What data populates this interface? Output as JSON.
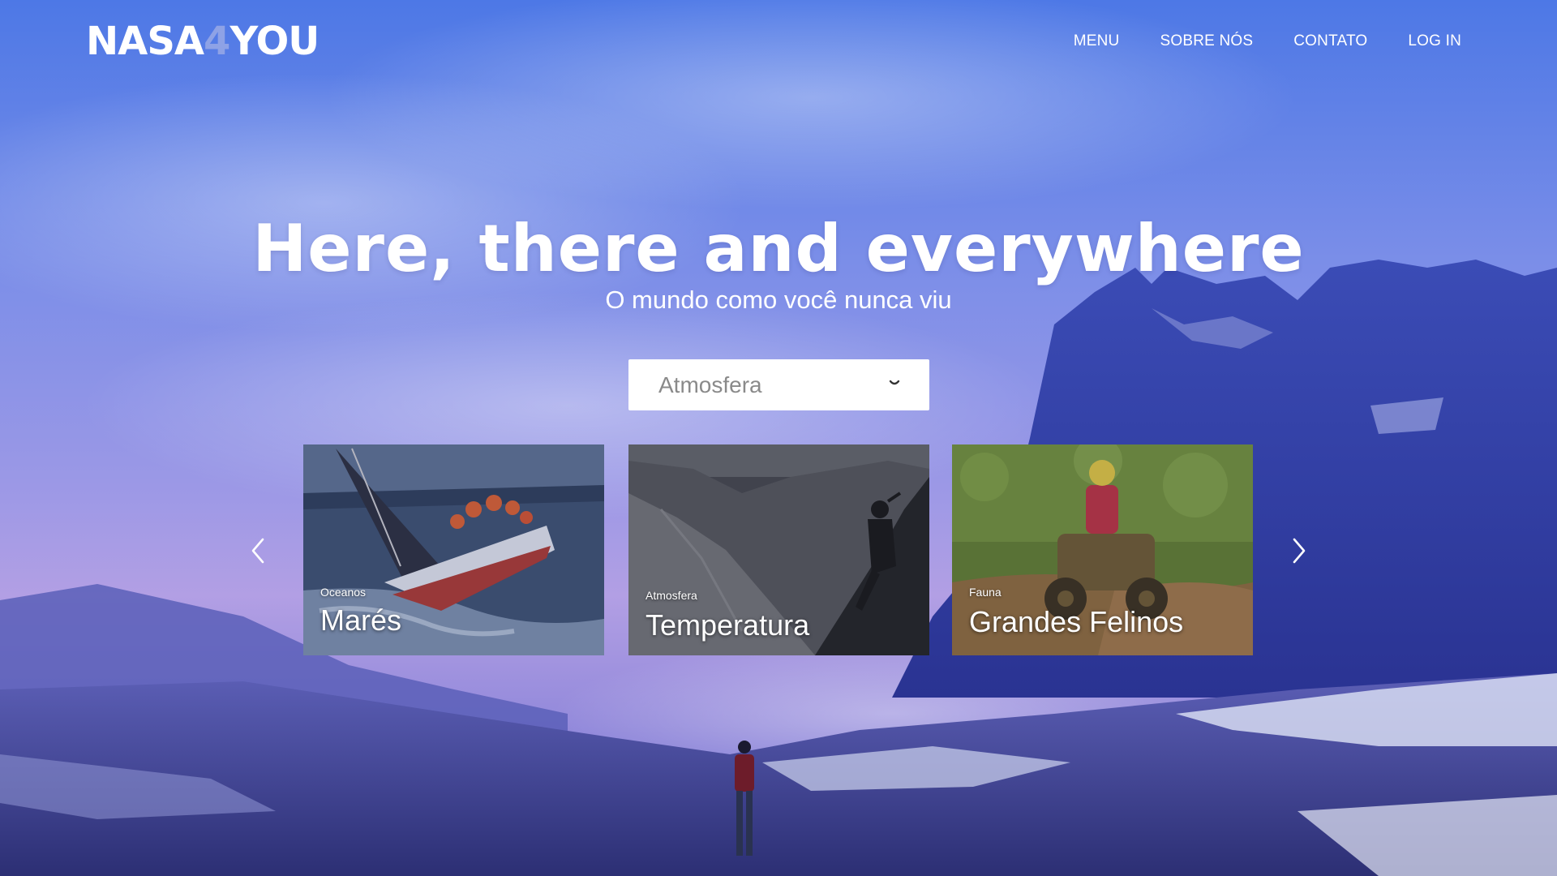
{
  "brand": {
    "logo_left": "NASA",
    "logo_four": "4",
    "logo_right": "YOU"
  },
  "nav": {
    "items": [
      "MENU",
      "SOBRE NÓS",
      "CONTATO",
      "LOG IN"
    ]
  },
  "hero": {
    "title": "Here, there and everywhere",
    "subtitle": "O mundo como você nunca viu"
  },
  "category_select": {
    "selected": "Atmosfera"
  },
  "carousel": {
    "cards": [
      {
        "category": "Oceanos",
        "title": "Marés"
      },
      {
        "category": "Atmosfera",
        "title": "Temperatura"
      },
      {
        "category": "Fauna",
        "title": "Grandes Felinos"
      }
    ]
  },
  "icons": {
    "prev": "chevron-left-icon",
    "next": "chevron-right-icon",
    "dropdown": "chevron-down-icon"
  },
  "colors": {
    "sky_top": "#4a6fe0",
    "sky_mid": "#8e8fe6",
    "horizon_pink": "#c7a9e2",
    "ground": "#3c3f8c",
    "text": "#ffffff",
    "select_text": "#8a8a8a"
  }
}
